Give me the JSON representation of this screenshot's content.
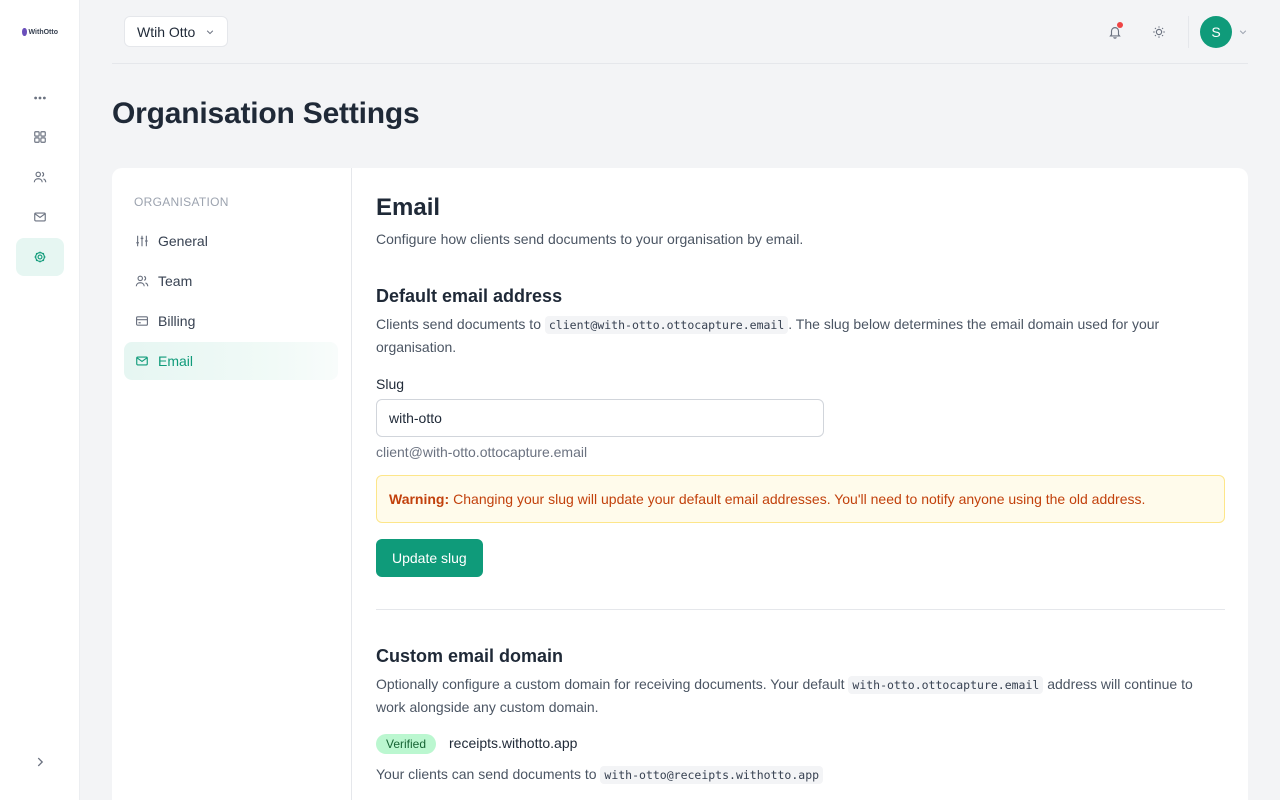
{
  "app": {
    "logo_text": "WithOtto"
  },
  "topbar": {
    "org_name": "Wtih Otto",
    "avatar_initial": "S"
  },
  "page": {
    "title": "Organisation Settings"
  },
  "settings_nav": {
    "heading": "ORGANISATION",
    "items": [
      {
        "label": "General",
        "icon": "sliders-icon"
      },
      {
        "label": "Team",
        "icon": "users-icon"
      },
      {
        "label": "Billing",
        "icon": "credit-card-icon"
      },
      {
        "label": "Email",
        "icon": "mail-icon",
        "active": true
      }
    ]
  },
  "email": {
    "title": "Email",
    "subtitle": "Configure how clients send documents to your organisation by email.",
    "default_section": {
      "heading": "Default email address",
      "desc_before": "Clients send documents to ",
      "desc_code": "client@with-otto.ottocapture.email",
      "desc_after": ". The slug below determines the email domain used for your organisation.",
      "slug_label": "Slug",
      "slug_value": "with-otto",
      "slug_hint": "client@with-otto.ottocapture.email",
      "warning_label": "Warning:",
      "warning_text": "Changing your slug will update your default email addresses. You'll need to notify anyone using the old address.",
      "update_button": "Update slug"
    },
    "custom_section": {
      "heading": "Custom email domain",
      "desc_before": "Optionally configure a custom domain for receiving documents. Your default ",
      "desc_code": "with-otto.ottocapture.email",
      "desc_after": " address will continue to work alongside any custom domain.",
      "status_badge": "Verified",
      "domain": "receipts.withotto.app",
      "send_before": "Your clients can send documents to ",
      "send_code": "with-otto@receipts.withotto.app"
    }
  },
  "colors": {
    "accent": "#0f9b7a",
    "warning_bg": "#fffbeb",
    "warning_text": "#c2410c",
    "verified_bg": "#bbf7d0"
  }
}
